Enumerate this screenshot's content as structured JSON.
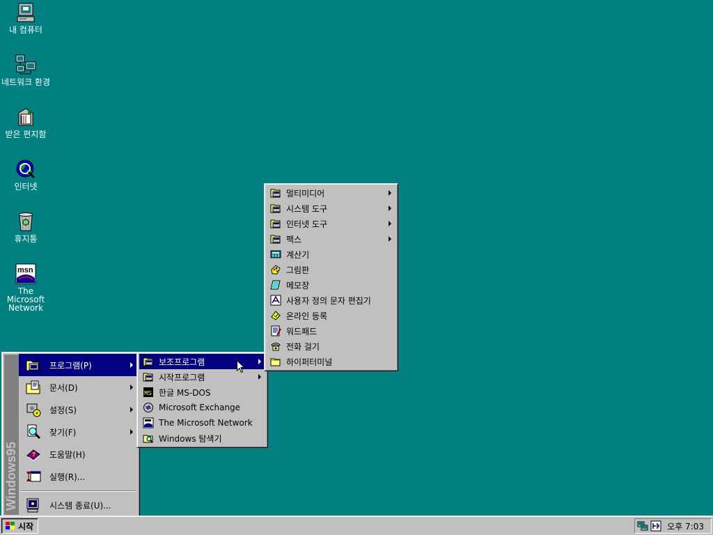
{
  "desktop": {
    "icons": [
      {
        "label": "내 컴퓨터",
        "icon": "my-computer-icon"
      },
      {
        "label": "네트워크 환경",
        "icon": "network-neighborhood-icon"
      },
      {
        "label": "받은 편지함",
        "icon": "inbox-icon"
      },
      {
        "label": "인터넷",
        "icon": "internet-icon"
      },
      {
        "label": "휴지통",
        "icon": "recycle-bin-icon"
      },
      {
        "label": "The Microsoft Network",
        "icon": "msn-icon"
      }
    ],
    "background_color": "#008080"
  },
  "start_menu": {
    "banner": "Windows95",
    "items": [
      {
        "label": "프로그램(P)",
        "icon": "programs-folder-icon",
        "submenu": true,
        "highlighted": true
      },
      {
        "label": "문서(D)",
        "icon": "documents-folder-icon",
        "submenu": true
      },
      {
        "label": "설정(S)",
        "icon": "settings-icon",
        "submenu": true
      },
      {
        "label": "찾기(F)",
        "icon": "find-magnifier-icon",
        "submenu": true
      },
      {
        "label": "도움말(H)",
        "icon": "help-book-icon",
        "submenu": false
      },
      {
        "label": "실행(R)...",
        "icon": "run-icon",
        "submenu": false
      },
      {
        "label": "시스템 종료(U)...",
        "icon": "shutdown-computer-icon",
        "submenu": false
      }
    ]
  },
  "programs_menu": {
    "items": [
      {
        "label": "보조프로그램",
        "icon": "program-group-icon",
        "submenu": true,
        "highlighted": true
      },
      {
        "label": "시작프로그램",
        "icon": "program-group-icon",
        "submenu": true
      },
      {
        "label": "한글 MS-DOS",
        "icon": "ms-dos-icon",
        "submenu": false
      },
      {
        "label": "Microsoft Exchange",
        "icon": "exchange-icon",
        "submenu": false
      },
      {
        "label": "The Microsoft Network",
        "icon": "msn-icon",
        "submenu": false
      },
      {
        "label": "Windows 탐색기",
        "icon": "explorer-icon",
        "submenu": false
      }
    ]
  },
  "accessories_menu": {
    "items": [
      {
        "label": "멀티미디어",
        "icon": "program-group-icon",
        "submenu": true
      },
      {
        "label": "시스템 도구",
        "icon": "program-group-icon",
        "submenu": true
      },
      {
        "label": "인터넷 도구",
        "icon": "program-group-icon",
        "submenu": true
      },
      {
        "label": "팩스",
        "icon": "program-group-icon",
        "submenu": true
      },
      {
        "label": "계산기",
        "icon": "calculator-icon",
        "submenu": false
      },
      {
        "label": "그림판",
        "icon": "paint-icon",
        "submenu": false
      },
      {
        "label": "메모장",
        "icon": "notepad-icon",
        "submenu": false
      },
      {
        "label": "사용자 정의 문자 편집기",
        "icon": "char-editor-icon",
        "submenu": false
      },
      {
        "label": "온라인 등록",
        "icon": "registration-icon",
        "submenu": false
      },
      {
        "label": "워드패드",
        "icon": "wordpad-icon",
        "submenu": false
      },
      {
        "label": "전화 걸기",
        "icon": "phone-dialer-icon",
        "submenu": false
      },
      {
        "label": "하이퍼터미널",
        "icon": "folder-icon",
        "submenu": false
      }
    ]
  },
  "taskbar": {
    "start_label": "시작",
    "clock": "오후 7:03",
    "tray_icons": [
      "network-tray-icon",
      "ime-tray-icon"
    ]
  },
  "colors": {
    "highlight": "#000080",
    "face": "#c0c0c0"
  }
}
